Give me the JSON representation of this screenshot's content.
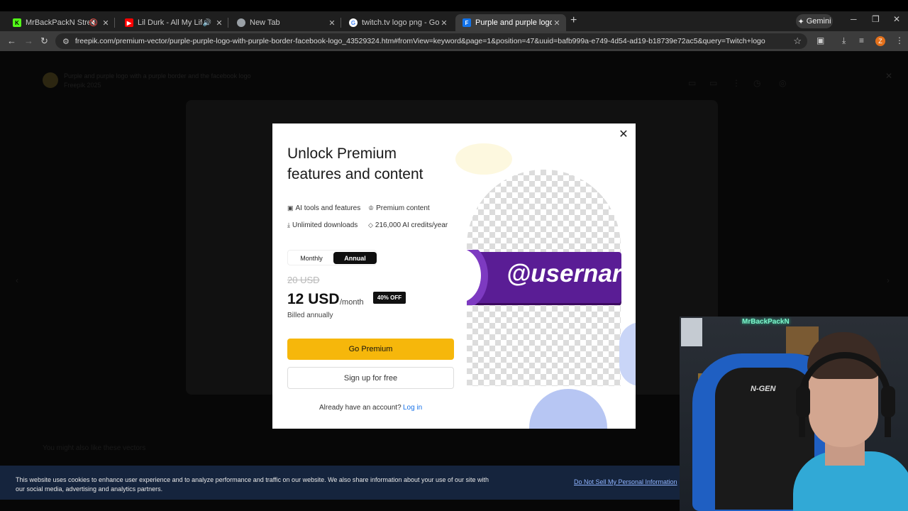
{
  "browser": {
    "tabs": [
      {
        "title": "MrBackPackN Stream - Wat",
        "favicon": "kick-icon",
        "favicon_color": "#53fc18",
        "favicon_text": "K",
        "audio": "muted"
      },
      {
        "title": "Lil Durk - All My Life ft. J. Co",
        "favicon": "youtube-icon",
        "favicon_color": "#ff0000",
        "favicon_text": "▶",
        "audio": "playing"
      },
      {
        "title": "New Tab",
        "favicon": "chrome-icon",
        "favicon_color": "#9aa0a6",
        "favicon_text": ""
      },
      {
        "title": "twitch.tv logo png - Google Sea",
        "favicon": "google-icon",
        "favicon_color": "#ffffff",
        "favicon_text": "G"
      },
      {
        "title": "Purple and purple logo with a p",
        "favicon": "freepik-icon",
        "favicon_color": "#1273eb",
        "favicon_text": "F",
        "active": true
      }
    ],
    "new_tab_glyph": "+",
    "gemini_label": "Gemini",
    "url": "freepik.com/premium-vector/purple-purple-logo-with-purple-border-facebook-logo_43529324.htm#fromView=keyword&page=1&position=47&uuid=bafb999a-e749-4d54-ad19-b18739e72ac5&query=Twitch+logo",
    "profile_initial": "Z"
  },
  "background_page": {
    "title": "Purple and purple logo with a purple border and the facebook logo",
    "subtitle": "Freepik 2025",
    "also_like": "You might also like these vectors"
  },
  "modal": {
    "title": "Unlock Premium features and content",
    "features": [
      {
        "icon": "ai-tools-icon",
        "label": "AI tools and features"
      },
      {
        "icon": "crown-icon",
        "label": "Premium content"
      },
      {
        "icon": "download-icon",
        "label": "Unlimited downloads"
      },
      {
        "icon": "tag-icon",
        "label": "216,000 AI credits/year"
      }
    ],
    "billing_options": {
      "monthly": "Monthly",
      "annual": "Annual",
      "selected": "Annual"
    },
    "old_price": "20 USD",
    "price": "12 USD",
    "per": "/month",
    "discount_badge": "40% OFF",
    "billing_note": "Billed annually",
    "primary_button": "Go Premium",
    "secondary_button": "Sign up for free",
    "login_question": "Already have an account?",
    "login_link": "Log in",
    "illustration_text": "@usernar",
    "colors": {
      "primary_button": "#f6b70b",
      "banner": "#5a1d95",
      "link": "#1a73e8"
    }
  },
  "cookie_banner": {
    "message": "This website uses cookies to enhance user experience and to analyze performance and traffic on our website. We also share information about your use of our site with our social media, advertising and analytics partners.",
    "link": "Do Not Sell My Personal Information"
  },
  "webcam": {
    "neon_sign": "MrBackPackN",
    "chair_brand": "N-GEN"
  }
}
